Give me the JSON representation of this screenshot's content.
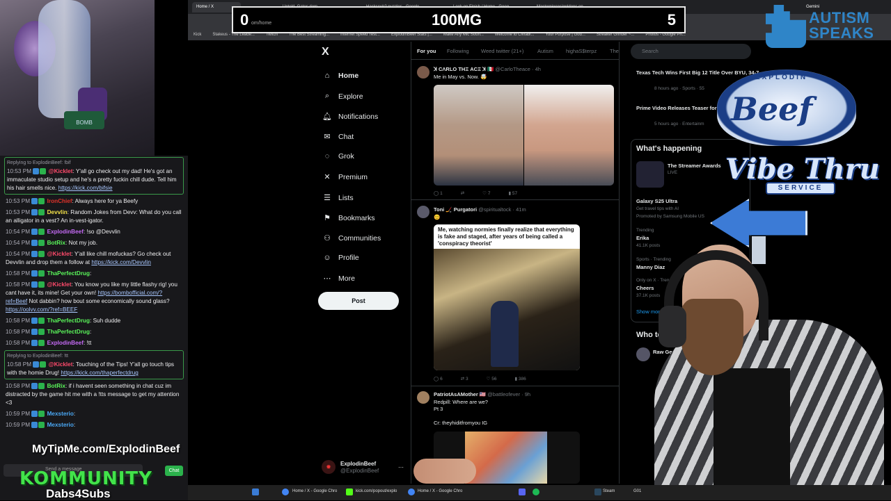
{
  "score": {
    "left": "0",
    "center": "100MG",
    "right": "5",
    "url_fragment": "om/home"
  },
  "browser": {
    "tabs": [
      "Home / X",
      "Untold_Gates dom",
      "Hackscy/r2 puzzles - Google",
      "Look on Finish / Home - Goog",
      "Masterpieces/goldens on"
    ],
    "gemini_label": "Gemini",
    "bookmarks": [
      "Kick",
      "Stakeus - The Leade...",
      "Twitch",
      "The Best Streaming...",
      "Internet Speed Test...",
      "ExplodinBeef Stats |...",
      "Make Any Mic Soun...",
      "Welcome to Civtabl...",
      "Your Purpose | God...",
      "Streaker Grinder ~...",
      "Photos - Google Ph..."
    ]
  },
  "chat": {
    "messages": [
      {
        "reply": "Replying to ExplodinBeef: !bif",
        "time": "10:53 PM",
        "user": "@Kicklet",
        "user_color": "#ff4a6b",
        "text": "Y'all go check out my dad! He's got an immaculate studio setup and he's a pretty fuckin chill dude. Tell him his hair smells nice.",
        "link": "https://kick.com/bifsie",
        "highlight": true
      },
      {
        "time": "10:53 PM",
        "user": "IronChief",
        "user_color": "#e0322a",
        "text": "Always here for ya Beefy"
      },
      {
        "time": "10:53 PM",
        "user": "Devvlin",
        "user_color": "#f5e34a",
        "text": "Random Jokes from Devv: What do you call an alligator in a vest? An in-vest-igator."
      },
      {
        "time": "10:54 PM",
        "user": "ExplodinBeef",
        "user_color": "#c56af5",
        "text": "!so @Devvlin"
      },
      {
        "time": "10:54 PM",
        "user": "BotRix",
        "user_color": "#5af55a",
        "text": "Not my job."
      },
      {
        "time": "10:54 PM",
        "user": "@Kicklet",
        "user_color": "#ff4a6b",
        "text": "Y'all like chill mofuckas? Go check out Devvlin and drop them a follow at",
        "link": "https://kick.com/Devvlin"
      },
      {
        "time": "10:58 PM",
        "user": "ThaPerfectDrug",
        "user_color": "#5af55a",
        "text": ""
      },
      {
        "time": "10:58 PM",
        "user": "@Kicklet",
        "user_color": "#ff4a6b",
        "text": "You know you like my little flashy rig! you cant have it, its mine! Get your own!",
        "link": "https://bombofficial.com/?ref=Beef",
        "text2": "Not dabbin? how bout some economically sound glass?",
        "link2": "https://oolvv.com/?ref=BEEF"
      },
      {
        "time": "10:58 PM",
        "user": "ThaPerfectDrug",
        "user_color": "#5af55a",
        "text": "Suh dudde"
      },
      {
        "time": "10:58 PM",
        "user": "ThaPerfectDrug",
        "user_color": "#5af55a",
        "text": ""
      },
      {
        "time": "10:58 PM",
        "user": "ExplodinBeef",
        "user_color": "#c56af5",
        "text": "!tt"
      },
      {
        "reply": "Replying to ExplodinBeef: !tt",
        "time": "10:58 PM",
        "user": "@Kicklet",
        "user_color": "#ff4a6b",
        "text": "Touching of the Tips! Y'all go touch tips with the homie Drug!",
        "link": "https://kick.com/thaperfectdrug",
        "highlight": true
      },
      {
        "time": "10:58 PM",
        "user": "BotRix",
        "user_color": "#5af55a",
        "text": "if i havent seen something in chat cuz im distracted by the game hit me with a !tts message to get my attention <3"
      },
      {
        "time": "10:59 PM",
        "user": "Mexsterio",
        "user_color": "#4aa8f5",
        "text": ""
      },
      {
        "time": "10:59 PM",
        "user": "Mexsterio",
        "user_color": "#4aa8f5",
        "text": ""
      }
    ],
    "input_placeholder": "Send a message",
    "send_label": "Chat"
  },
  "overlays": {
    "tipme": "MyTipMe.com/ExplodinBeef",
    "kommunity": "KOMMUNITY",
    "dabs": "Dabs4Subs",
    "autism_line1": "AUTISM",
    "autism_line2": "SPEAKS",
    "logo_top": "EXPLODIN",
    "logo_word": "Beef",
    "logo_vibe": "Vibe Thru",
    "logo_service": "SERVICE",
    "rig_label": "BOMB"
  },
  "x": {
    "logo": "X",
    "nav": [
      {
        "label": "Home",
        "icon": "⌂"
      },
      {
        "label": "Explore",
        "icon": "⌕"
      },
      {
        "label": "Notifications",
        "icon": "🔔︎"
      },
      {
        "label": "Chat",
        "icon": "✉"
      },
      {
        "label": "Grok",
        "icon": "◌"
      },
      {
        "label": "Premium",
        "icon": "✕"
      },
      {
        "label": "Lists",
        "icon": "☰"
      },
      {
        "label": "Bookmarks",
        "icon": "⚑"
      },
      {
        "label": "Communities",
        "icon": "⚇"
      },
      {
        "label": "Profile",
        "icon": "☺"
      },
      {
        "label": "More",
        "icon": "⋯"
      }
    ],
    "post_label": "Post",
    "account": {
      "name": "ExplodinBeef",
      "handle": "@ExplodinBeef"
    },
    "feed_tabs": [
      "For you",
      "Following",
      "Weed twitter (21+)",
      "Autism",
      "highaS$terpz",
      "The"
    ],
    "tweets": [
      {
        "name": "ꓘ CΛRLO THΞ ACΞ ꓘ 🇲🇽",
        "handle": "@CarloTheace · 4h",
        "text": "Me in May vs. Now. 🤯",
        "replies": "1",
        "retweets": "",
        "likes": "7",
        "views": "57"
      },
      {
        "name": "Toni 🏒 Purgatori",
        "handle": "@spiritualtock · 41m",
        "text": "😊",
        "image_caption": "Me, watching normies finally realize that everything is fake and staged, after years of being called a 'conspiracy theorist'",
        "replies": "6",
        "retweets": "3",
        "likes": "56",
        "views": "386"
      },
      {
        "name": "PatriotAsAMother 🇺🇸",
        "handle": "@battleofever · 9h",
        "text": "Redpill: Where are we?",
        "text2": "Pt 3",
        "text3": "Cr: theyhiditfromyou IG"
      }
    ],
    "search_placeholder": "Search",
    "trends_top": [
      {
        "title": "Texas Tech Wins First Big 12 Title Over BYU, 34-7",
        "meta": "8 hours ago · Sports · 55"
      },
      {
        "title": "Prime Video Releases Teaser for Fifth and Final Season of The",
        "meta": "5 hours ago · Entertainm"
      }
    ],
    "whats_happening": "What's happening",
    "trends": [
      {
        "title": "The Streamer Awards",
        "meta": "LIVE"
      },
      {
        "title": "Galaxy S25 Ultra",
        "meta": "Get travel tips with AI",
        "meta2": "Promoted by Samsung Mobile US"
      },
      {
        "title": "Erika",
        "meta": "Trending",
        "meta2": "41.1K posts"
      },
      {
        "title": "Manny Diaz",
        "meta": "Sports · Trending"
      },
      {
        "title": "Cheers",
        "meta": "Only on X · Trending",
        "meta2": "37.1K posts"
      }
    ],
    "show_more": "Show more",
    "who_to_follow": "Who to follo",
    "follow_name": "Raw Gen"
  },
  "taskbar": {
    "items": [
      "Home / X - Google Chro",
      "kick.com/popout/explo",
      "Home / X - Google Chro",
      "Steam",
      "G01"
    ]
  }
}
